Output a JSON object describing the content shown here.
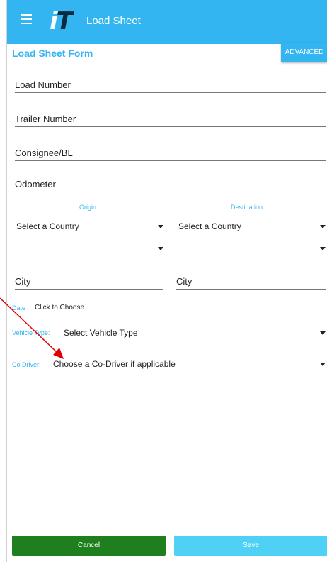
{
  "appbar": {
    "logo_text": "iT",
    "title": "Load Sheet"
  },
  "form": {
    "title": "Load Sheet Form",
    "advanced_label": "ADVANCED",
    "load_number_placeholder": "Load Number",
    "trailer_number_placeholder": "Trailer Number",
    "consignee_placeholder": "Consignee/BL",
    "odometer_placeholder": "Odometer"
  },
  "origin": {
    "label": "Origin",
    "country_select": "Select a Country",
    "state_select": "",
    "city_placeholder": "City"
  },
  "destination": {
    "label": "Destination",
    "country_select": "Select a Country",
    "state_select": "",
    "city_placeholder": "City"
  },
  "date": {
    "label": "Date :",
    "value": "Click to Choose"
  },
  "vehicle_type": {
    "label": "Vehicle Type:",
    "value": "Select Vehicle Type"
  },
  "co_driver": {
    "label": "Co Driver:",
    "value": "Choose a Co-Driver if applicable"
  },
  "buttons": {
    "cancel": "Cancel",
    "save": "Save"
  },
  "colors": {
    "accent": "#33b5f1",
    "cancel": "#1f7f1f",
    "save": "#4fd0f5",
    "annotation_arrow": "#e00000"
  }
}
